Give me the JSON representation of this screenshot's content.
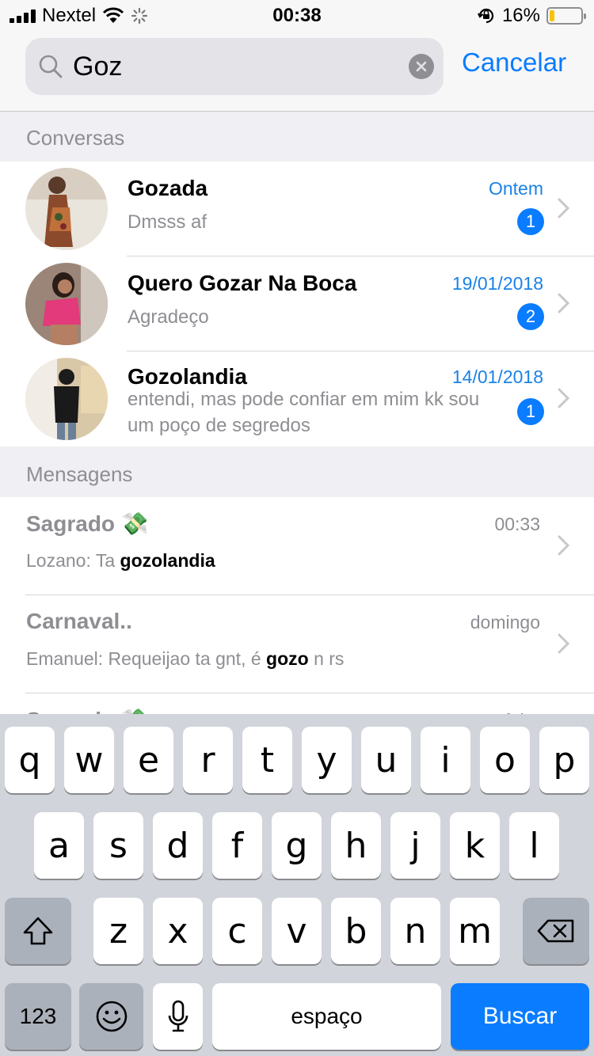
{
  "status_bar": {
    "carrier": "Nextel",
    "time": "00:38",
    "battery_percent": "16%",
    "battery_level": 0.16,
    "signal_icon": "signal-bars-icon",
    "wifi_icon": "wifi-icon",
    "activity_icon": "loading-spinner-icon",
    "lock_icon": "orientation-lock-icon"
  },
  "search": {
    "value": "Goz",
    "cancel_label": "Cancelar"
  },
  "conversations": {
    "header": "Conversas",
    "items": [
      {
        "name": "Gozada",
        "preview": "Dmsss af",
        "date": "Ontem",
        "unread": "1"
      },
      {
        "name": "Quero Gozar Na Boca",
        "preview": "Agradeço",
        "date": "19/01/2018",
        "unread": "2"
      },
      {
        "name": "Gozolandia",
        "preview": "entendi, mas pode confiar em mim kk sou um poço de segredos",
        "date": "14/01/2018",
        "unread": "1"
      }
    ]
  },
  "messages": {
    "header": "Mensagens",
    "items": [
      {
        "title": "Sagrado 💸",
        "time": "00:33",
        "sender": "Lozano:",
        "before": " Ta ",
        "match": "gozolandia",
        "after": ""
      },
      {
        "title": "Carnaval..",
        "time": "domingo",
        "sender": "Emanuel:",
        "before": " Requeijao ta gnt, é ",
        "match": "gozo",
        "after": " n rs"
      },
      {
        "title": "Sagrado 💸",
        "time": "sexta-feira"
      }
    ]
  },
  "keyboard": {
    "row1": [
      "q",
      "w",
      "e",
      "r",
      "t",
      "y",
      "u",
      "i",
      "o",
      "p"
    ],
    "row2": [
      "a",
      "s",
      "d",
      "f",
      "g",
      "h",
      "j",
      "k",
      "l"
    ],
    "row3": [
      "z",
      "x",
      "c",
      "v",
      "b",
      "n",
      "m"
    ],
    "numbers_label": "123",
    "space_label": "espaço",
    "search_label": "Buscar",
    "emoji_icon": "emoji-icon",
    "mic_icon": "microphone-icon",
    "shift_icon": "shift-icon",
    "backspace_icon": "backspace-icon"
  },
  "colors": {
    "accent": "#0a7cff",
    "date_blue": "#1a82e6",
    "battery_yellow": "#f5c400",
    "keyboard_bg": "#d1d4da"
  }
}
